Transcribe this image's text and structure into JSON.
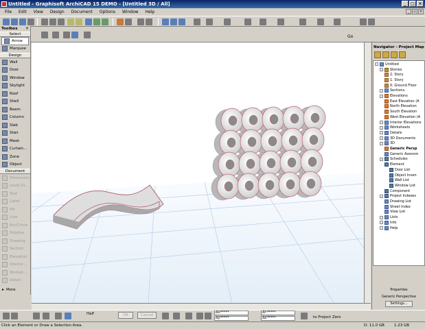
{
  "window": {
    "title": "Untitled - Graphisoft ArchiCAD 15 DEMO - [Untitled 3D / All]"
  },
  "menu": [
    "File",
    "Edit",
    "View",
    "Design",
    "Document",
    "Options",
    "Window",
    "Help"
  ],
  "toolbar": {
    "go_label": "Go"
  },
  "toolbox": {
    "title": "Toolbox",
    "select_header": "Select",
    "select_items": [
      "Arrow",
      "Marquee"
    ],
    "design_header": "Design",
    "design_items": [
      "Wall",
      "Door",
      "Window",
      "Skylight",
      "Roof",
      "Shell",
      "Beam",
      "Column",
      "Slab",
      "Stair",
      "Mesh",
      "Curtain...",
      "Zone",
      "Object"
    ],
    "document_header": "Document",
    "document_items": [
      "Dimension",
      "Level Di...",
      "Text",
      "Label",
      "Fill",
      "Line",
      "Arc/Circle",
      "Polyline",
      "Drawing",
      "Section",
      "Elevation",
      "Interior...",
      "Worksh...",
      "Detail"
    ],
    "more_label": "More"
  },
  "navigator": {
    "title": "Navigator - Project Map",
    "tree": [
      {
        "label": "Untitled",
        "level": 0,
        "icon": "tico"
      },
      {
        "label": "Stories",
        "level": 1,
        "icon": "tico story"
      },
      {
        "label": "2. Story",
        "level": 2,
        "icon": "tico story"
      },
      {
        "label": "1. Story",
        "level": 2,
        "icon": "tico story"
      },
      {
        "label": "0. Ground Floor",
        "level": 2,
        "icon": "tico story"
      },
      {
        "label": "Sections",
        "level": 1,
        "icon": "tico"
      },
      {
        "label": "Elevations",
        "level": 1,
        "icon": "tico elev"
      },
      {
        "label": "East Elevation (A",
        "level": 2,
        "icon": "tico elev"
      },
      {
        "label": "North Elevation",
        "level": 2,
        "icon": "tico elev"
      },
      {
        "label": "South Elevation",
        "level": 2,
        "icon": "tico elev"
      },
      {
        "label": "West Elevation (A",
        "level": 2,
        "icon": "tico elev"
      },
      {
        "label": "Interior Elevations",
        "level": 1,
        "icon": "tico"
      },
      {
        "label": "Worksheets",
        "level": 1,
        "icon": "tico"
      },
      {
        "label": "Details",
        "level": 1,
        "icon": "tico"
      },
      {
        "label": "3D Documents",
        "level": 1,
        "icon": "tico"
      },
      {
        "label": "3D",
        "level": 1,
        "icon": "tico"
      },
      {
        "label": "Generic Persp",
        "level": 2,
        "icon": "tico elev",
        "bold": true
      },
      {
        "label": "Generic Axonom",
        "level": 2,
        "icon": "tico"
      },
      {
        "label": "Schedules",
        "level": 1,
        "icon": "tico sched"
      },
      {
        "label": "Element",
        "level": 2,
        "icon": "tico sched"
      },
      {
        "label": "Door List",
        "level": 3,
        "icon": "tico sched"
      },
      {
        "label": "Object Inven",
        "level": 3,
        "icon": "tico sched"
      },
      {
        "label": "Wall List",
        "level": 3,
        "icon": "tico sched"
      },
      {
        "label": "Window List",
        "level": 3,
        "icon": "tico sched"
      },
      {
        "label": "Component",
        "level": 2,
        "icon": "tico sched"
      },
      {
        "label": "Project Indexes",
        "level": 1,
        "icon": "tico sched"
      },
      {
        "label": "Drawing List",
        "level": 2,
        "icon": "tico"
      },
      {
        "label": "Sheet Index",
        "level": 2,
        "icon": "tico"
      },
      {
        "label": "View List",
        "level": 2,
        "icon": "tico"
      },
      {
        "label": "Lists",
        "level": 1,
        "icon": "tico"
      },
      {
        "label": "Info",
        "level": 1,
        "icon": "tico"
      },
      {
        "label": "Help",
        "level": 1,
        "icon": "tico"
      }
    ],
    "props_header": "Properties",
    "props_value": "Generic Perspective",
    "settings_button": "Settings..."
  },
  "infobox": {
    "ok_label": "OK",
    "cancel_label": "Cancel",
    "half_label": "Half",
    "coord_values": [
      "*****",
      "*****",
      "*****",
      "*****"
    ],
    "coord_labels": [
      "Δx:",
      "Δy:",
      "Δr:",
      "Δz:"
    ],
    "to_project_zero": "to Project Zero"
  },
  "status": {
    "hint": "Click an Element or Draw a Selection Area.",
    "disk": "D: 11.0 GB",
    "memory": "1.23 GB"
  }
}
